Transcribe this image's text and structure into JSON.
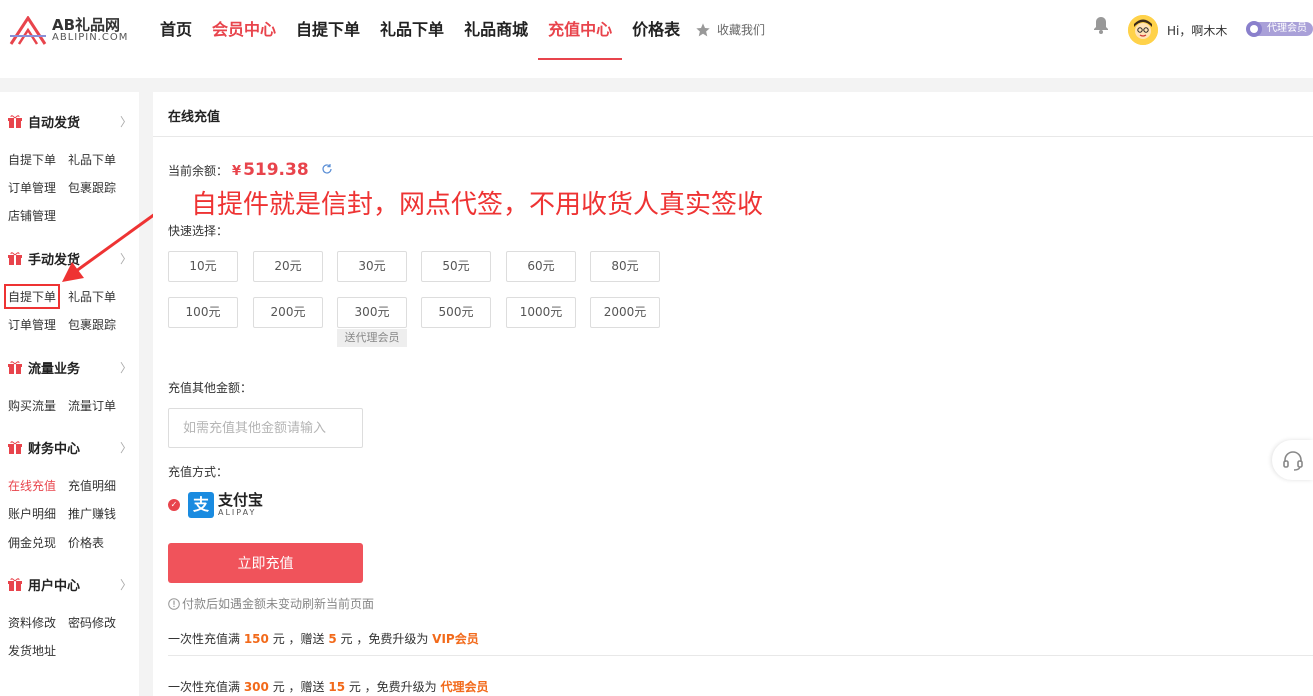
{
  "header": {
    "logo_brand": "AB礼品网",
    "logo_domain": "ABLIPIN.COM",
    "nav": [
      {
        "label": "首页",
        "red": false
      },
      {
        "label": "会员中心",
        "red": true
      },
      {
        "label": "自提下单",
        "red": false
      },
      {
        "label": "礼品下单",
        "red": false
      },
      {
        "label": "礼品商城",
        "red": false
      },
      {
        "label": "充值中心",
        "red": true,
        "active": true
      },
      {
        "label": "价格表",
        "red": false
      }
    ],
    "favorite_label": "收藏我们",
    "greeting": "Hi，啊木木",
    "agent_badge": "代理会员"
  },
  "sidebar": {
    "groups": [
      {
        "title": "自动发货",
        "links": [
          "自提下单",
          "礼品下单",
          "订单管理",
          "包裹跟踪",
          "店铺管理"
        ]
      },
      {
        "title": "手动发货",
        "links": [
          "自提下单",
          "礼品下单",
          "订单管理",
          "包裹跟踪"
        ]
      },
      {
        "title": "流量业务",
        "links": [
          "购买流量",
          "流量订单"
        ]
      },
      {
        "title": "财务中心",
        "links": [
          "在线充值",
          "充值明细",
          "账户明细",
          "推广赚钱",
          "佣金兑现",
          "价格表"
        ]
      },
      {
        "title": "用户中心",
        "links": [
          "资料修改",
          "密码修改",
          "发货地址"
        ]
      }
    ]
  },
  "main": {
    "title": "在线充值",
    "balance_label": "当前余额：",
    "currency": "¥",
    "balance": "519.38",
    "annotation": "自提件就是信封，网点代签，不用收货人真实签收",
    "quick_label": "快速选择：",
    "amounts": [
      "10元",
      "20元",
      "30元",
      "50元",
      "60元",
      "80元",
      "100元",
      "200元",
      "300元",
      "500元",
      "1000元",
      "2000元"
    ],
    "gift_tag": "送代理会员",
    "other_label": "充值其他金额：",
    "other_placeholder": "如需充值其他金额请输入",
    "method_label": "充值方式：",
    "alipay_cn": "支付宝",
    "alipay_en": "ALIPAY",
    "submit_label": "立即充值",
    "hint": "付款后如遇金额未变动刷新当前页面",
    "promo1": {
      "pre": "一次性充值满 ",
      "amount": "150",
      "mid1": " 元 ，赠送 ",
      "gift": "5",
      "mid2": " 元 ，免费升级为 ",
      "level": "VIP会员"
    },
    "promo2": {
      "pre": "一次性充值满 ",
      "amount": "300",
      "mid1": " 元 ，赠送 ",
      "gift": "15",
      "mid2": " 元 ，免费升级为 ",
      "level": "代理会员"
    }
  },
  "colors": {
    "accent": "#e8444c",
    "promo": "#f26a1b",
    "button": "#f0535b"
  }
}
